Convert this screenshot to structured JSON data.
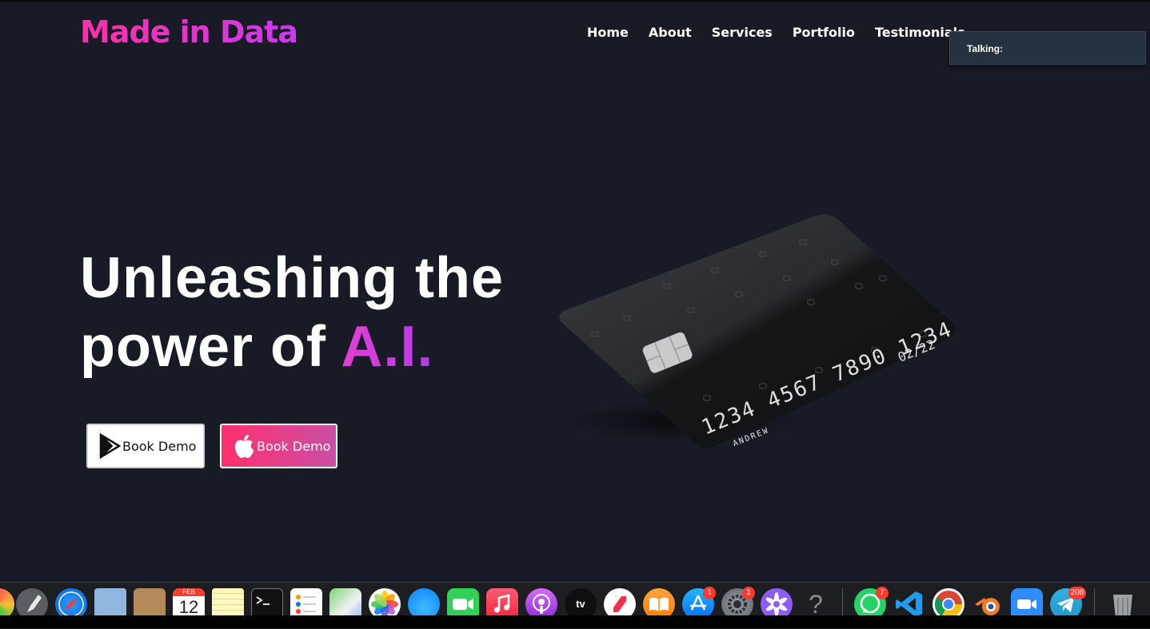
{
  "brand": {
    "name": "Made in Data"
  },
  "nav": {
    "items": [
      "Home",
      "About",
      "Services",
      "Portfolio",
      "Testimonials"
    ]
  },
  "popup": {
    "label": "Talking:"
  },
  "hero": {
    "line1": "Unleashing the",
    "line2_prefix": "power of ",
    "line2_accent": "A.I."
  },
  "buttons": {
    "play_label": "Book Demo",
    "apple_label": "Book Demo"
  },
  "card": {
    "number": "1234 4567 7890 1234",
    "holder": "ANDREW",
    "expiry": "02/22"
  },
  "dock": {
    "calendar_month": "FEB",
    "calendar_day": "12",
    "tv_label": "tv",
    "help_glyph": "?",
    "badges": {
      "app_store": "1",
      "settings": "1",
      "whatsapp": "7",
      "telegram": "208"
    }
  },
  "colors": {
    "background": "#181b25",
    "brand_gradient": [
      "#ff2fa6",
      "#c83bf0"
    ],
    "accent": "#d13de0",
    "apple_button_gradient": [
      "#ff2f6d",
      "#c94fa4"
    ]
  }
}
